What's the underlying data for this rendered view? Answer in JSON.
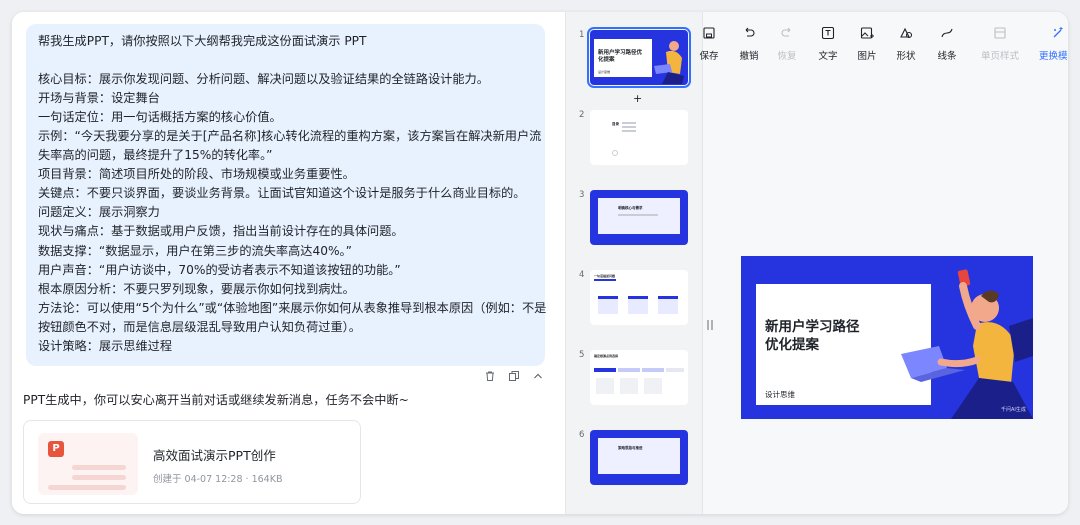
{
  "chat": {
    "prompt_lines": [
      "帮我生成PPT，请你按照以下大纲帮我完成这份面试演示 PPT",
      "",
      "核心目标：展示你发现问题、分析问题、解决问题以及验证结果的全链路设计能力。",
      "开场与背景：设定舞台",
      "一句话定位：用一句话概括方案的核心价值。",
      "示例：“今天我要分享的是关于[产品名称]核心转化流程的重构方案，该方案旨在解决新用户流",
      "失率高的问题，最终提升了15%的转化率。”",
      "项目背景：简述项目所处的阶段、市场规模或业务重要性。",
      "关键点：不要只谈界面，要谈业务背景。让面试官知道这个设计是服务于什么商业目标的。",
      "问题定义：展示洞察力",
      "现状与痛点：基于数据或用户反馈，指出当前设计存在的具体问题。",
      "数据支撑：“数据显示，用户在第三步的流失率高达40%。”",
      "用户声音：“用户访谈中，70%的受访者表示不知道该按钮的功能。”",
      "根本原因分析：不要只罗列现象，要展示你如何找到病灶。",
      "方法论：可以使用“5个为什么”或“体验地图”来展示你如何从表象推导到根本原因（例如：不是",
      "按钮颜色不对，而是信息层级混乱导致用户认知负荷过重）。",
      "设计策略：展示思维过程"
    ],
    "status": "PPT生成中，你可以安心离开当前对话或继续发新消息，任务不会中断~",
    "file_card": {
      "badge": "P",
      "title": "高效面试演示PPT创作",
      "meta": "创建于 04-07 12:28 · 164KB"
    }
  },
  "slides": {
    "items": [
      {
        "num": "1",
        "title": "新用户学习路径优化提案",
        "subtitle": "设计思维"
      },
      {
        "num": "2",
        "label": "目录"
      },
      {
        "num": "3",
        "label": "明确核心与需求"
      },
      {
        "num": "4",
        "label": "一句话描述问题"
      },
      {
        "num": "5",
        "label": "确定根源点到选择"
      },
      {
        "num": "6",
        "label": "策略思路与推进"
      }
    ],
    "add": "+"
  },
  "toolbar": {
    "save": "保存",
    "undo": "撤销",
    "redo": "恢复",
    "text": "文字",
    "image": "图片",
    "shape": "形状",
    "line": "线条",
    "single_style": "单页样式",
    "change_template": "更换模板"
  },
  "canvas": {
    "title_line1": "新用户学习路径",
    "title_line2": "优化提案",
    "subtitle": "设计思维",
    "logo": "千问AI生成"
  },
  "colors": {
    "accent": "#3370ff",
    "slide_blue": "#2634e0",
    "bubble": "#e8f1fe",
    "ppt_red": "#e6553c",
    "figure_orange": "#f4b53f"
  }
}
